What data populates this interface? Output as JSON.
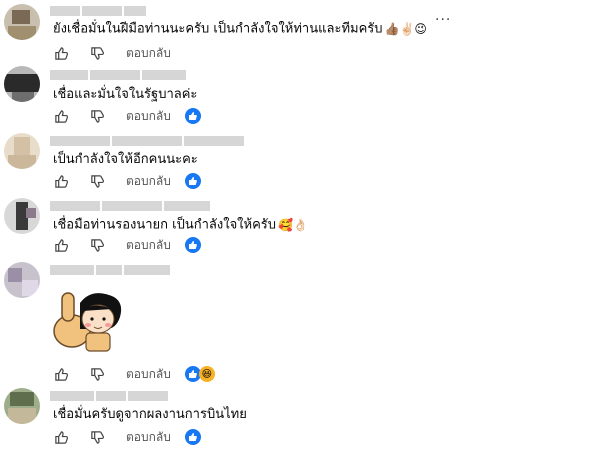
{
  "more_label": "···",
  "reply_label": "ตอบกลับ",
  "comments": [
    {
      "text": "ยังเชื่อมั่นในฝีมือท่านนะครับ เป็นกำลังใจให้ท่านและทีมครับ",
      "emojis": "👍🏽✌🏻😉"
    },
    {
      "text": "เชื่อและมั่นใจในรัฐบาลค่ะ"
    },
    {
      "text": "เป็นกำลังใจให้อีกคนนะคะ"
    },
    {
      "text": "เชื่อมือท่านรองนายก เป็นกำลังใจให้ครับ",
      "emojis": "🥰👌🏻"
    },
    {
      "text": ""
    },
    {
      "text": "เชื่อมั่นครับดูจากผลงานการบินไทย"
    }
  ],
  "colors": {
    "like": "#1877f2",
    "haha": "#f7b125",
    "reply": "#555555"
  }
}
